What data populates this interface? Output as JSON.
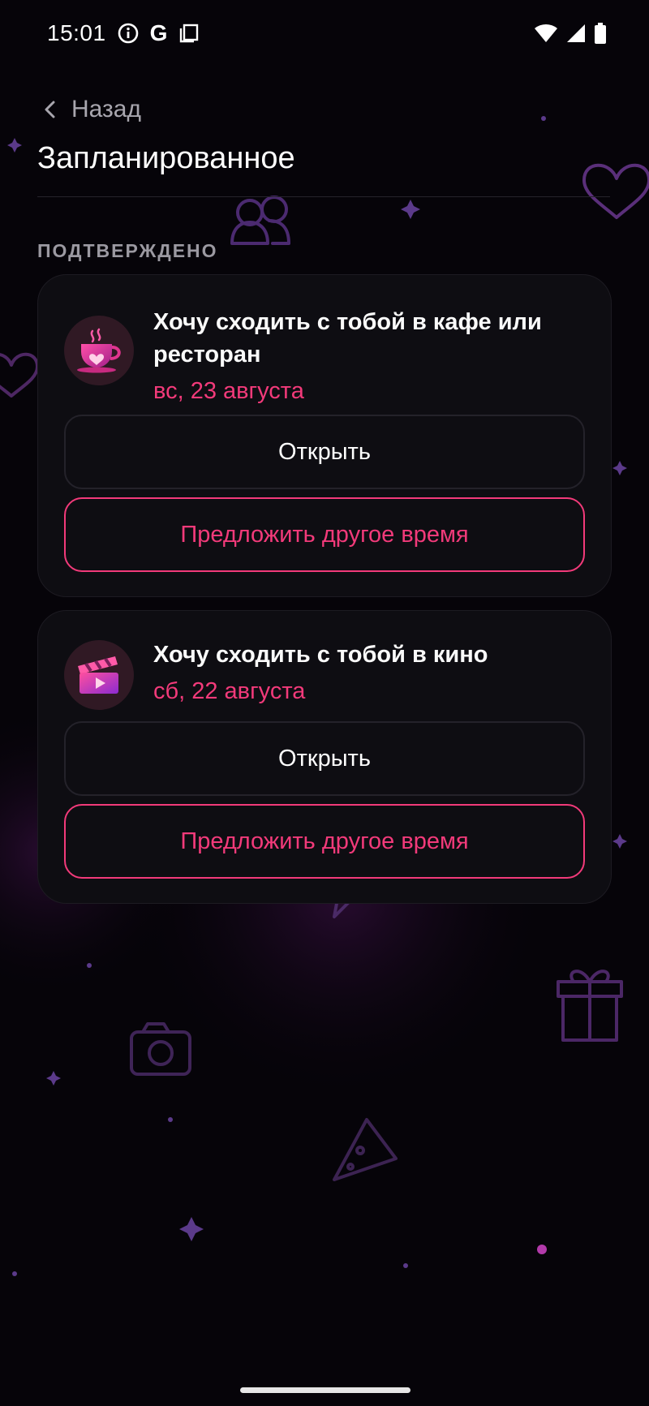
{
  "status_bar": {
    "time": "15:01",
    "left_icons": [
      "info-icon",
      "google-icon",
      "copy-icon"
    ],
    "right_icons": [
      "wifi-icon",
      "signal-icon",
      "battery-icon"
    ]
  },
  "nav": {
    "back_label": "Назад",
    "back_icon": "chevron-left-icon"
  },
  "page": {
    "title": "Запланированное"
  },
  "section": {
    "label": "ПОДТВЕРЖДЕНО"
  },
  "plans": [
    {
      "icon": "coffee-cup-icon",
      "title_line1": "Хочу сходить с тобой в кафе или",
      "title_line2": "ресторан",
      "date": "вс, 23 августа",
      "open_label": "Открыть",
      "propose_label": "Предложить другое время"
    },
    {
      "icon": "clapperboard-icon",
      "title_line1": "Хочу сходить с тобой в кино",
      "date": "сб, 22 августа",
      "open_label": "Открыть",
      "propose_label": "Предложить другое время"
    }
  ],
  "colors": {
    "background": "#060409",
    "card": "#0e0d12",
    "accent": "#f23a7a",
    "muted_text": "#9b99a1"
  }
}
